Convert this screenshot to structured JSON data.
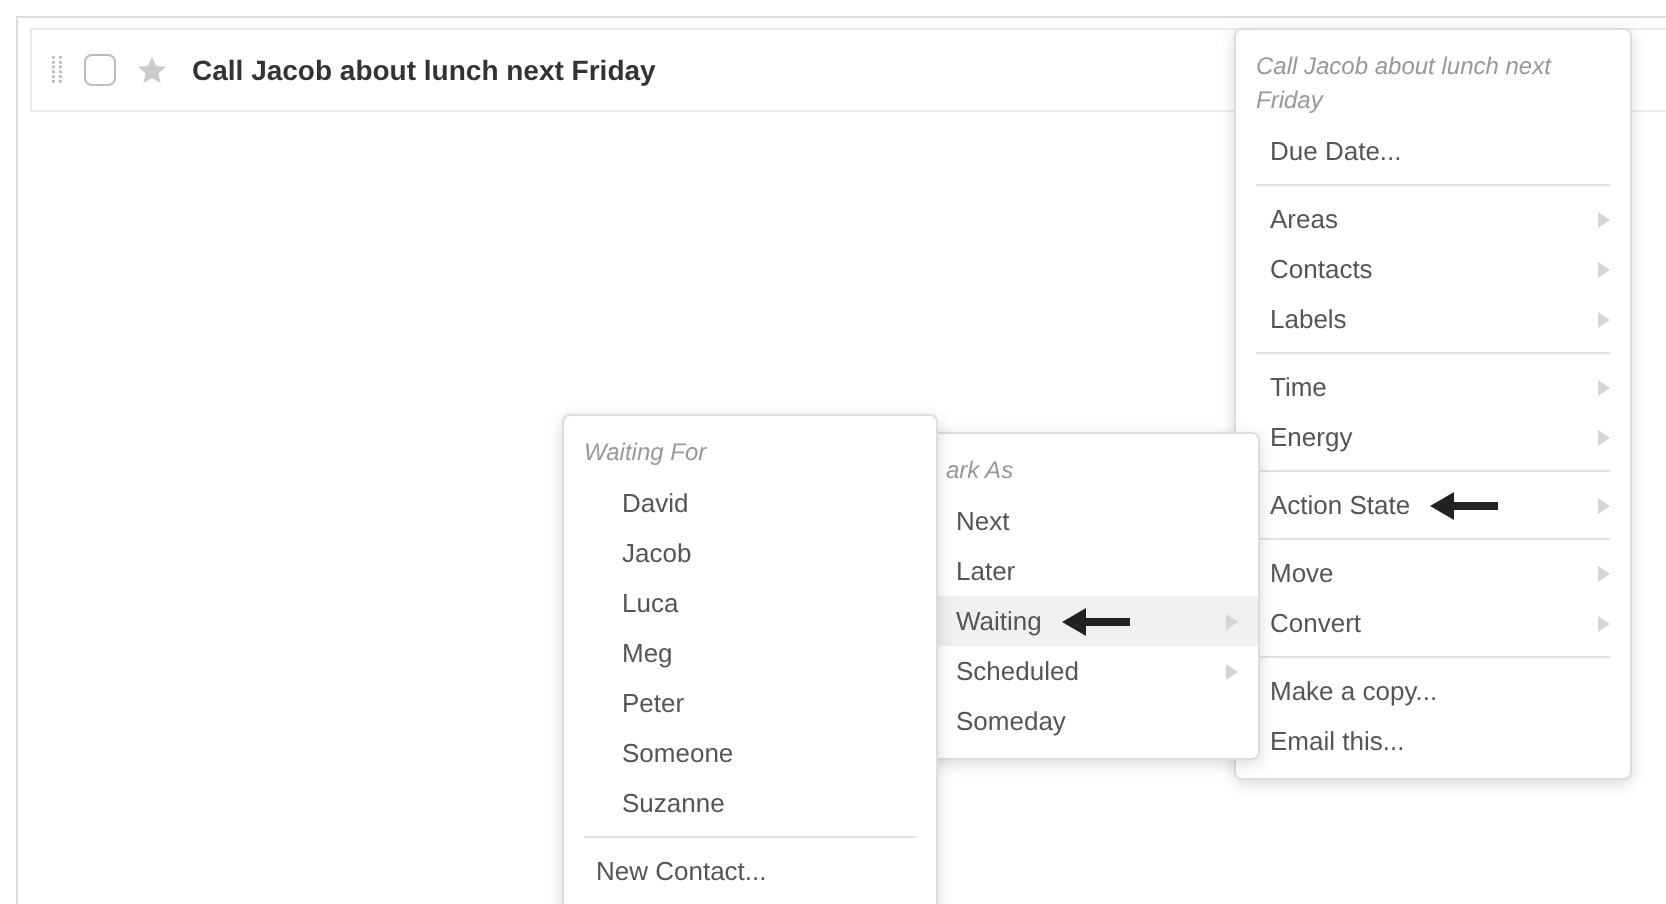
{
  "task": {
    "title": "Call Jacob about lunch next Friday",
    "checked": false,
    "starred": false
  },
  "context_menu": {
    "header": "Call Jacob about lunch next Friday",
    "groups": [
      [
        {
          "label": "Due Date...",
          "submenu": false,
          "arrow": false
        }
      ],
      [
        {
          "label": "Areas",
          "submenu": true,
          "arrow": false
        },
        {
          "label": "Contacts",
          "submenu": true,
          "arrow": false
        },
        {
          "label": "Labels",
          "submenu": true,
          "arrow": false
        }
      ],
      [
        {
          "label": "Time",
          "submenu": true,
          "arrow": false
        },
        {
          "label": "Energy",
          "submenu": true,
          "arrow": false
        }
      ],
      [
        {
          "label": "Action State",
          "submenu": true,
          "arrow": true
        }
      ],
      [
        {
          "label": "Move",
          "submenu": true,
          "arrow": false
        },
        {
          "label": "Convert",
          "submenu": true,
          "arrow": false
        }
      ],
      [
        {
          "label": "Make a copy...",
          "submenu": false,
          "arrow": false
        },
        {
          "label": "Email this...",
          "submenu": false,
          "arrow": false
        }
      ]
    ]
  },
  "mark_as_menu": {
    "header": "ark As",
    "items": [
      {
        "label": "Next",
        "selected": false,
        "submenu": false,
        "arrow": false
      },
      {
        "label": "Later",
        "selected": false,
        "submenu": false,
        "arrow": false
      },
      {
        "label": "Waiting",
        "selected": true,
        "submenu": true,
        "arrow": true
      },
      {
        "label": "Scheduled",
        "selected": false,
        "submenu": true,
        "arrow": false
      },
      {
        "label": "Someday",
        "selected": false,
        "submenu": false,
        "arrow": false
      }
    ]
  },
  "waiting_for_menu": {
    "header": "Waiting For",
    "items": [
      "David",
      "Jacob",
      "Luca",
      "Meg",
      "Peter",
      "Someone",
      "Suzanne"
    ],
    "footer": "New Contact..."
  }
}
